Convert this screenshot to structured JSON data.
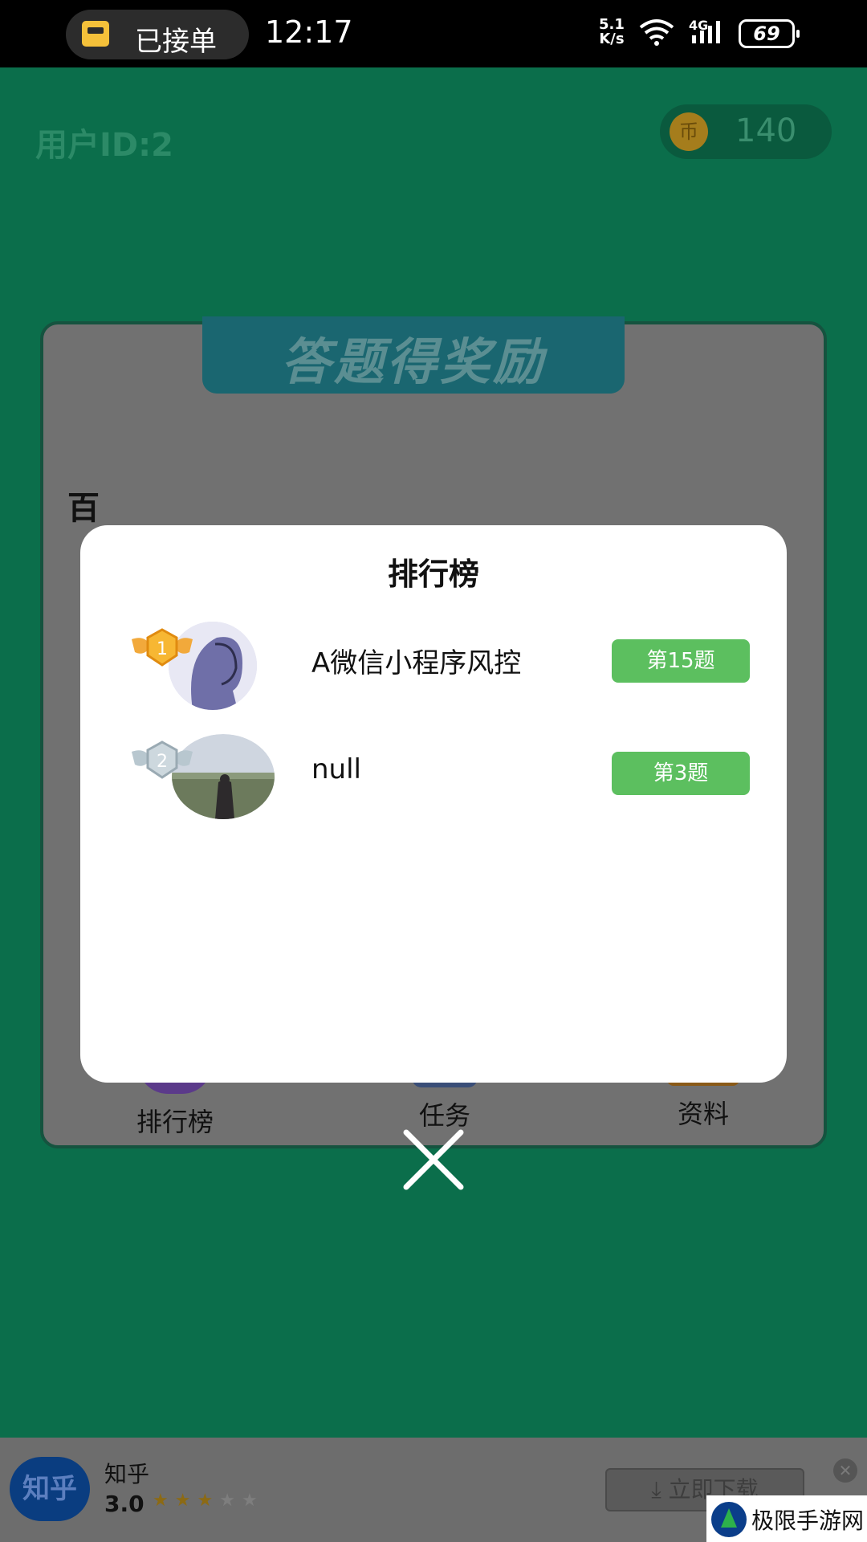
{
  "status_bar": {
    "notification": "已接单",
    "time": "12:17",
    "net_speed_value": "5.1",
    "net_speed_unit": "K/s",
    "signal_label": "4G",
    "battery": "69"
  },
  "app": {
    "user_id": "用户ID:2",
    "coin_symbol": "币",
    "coin_count": "140",
    "card_title": "答题得奖励",
    "partial_text": "百",
    "nav": [
      {
        "label": "排行榜",
        "icon": "crown-icon"
      },
      {
        "label": "任务",
        "icon": "clipboard-icon"
      },
      {
        "label": "资料",
        "icon": "id-card-icon"
      }
    ]
  },
  "modal": {
    "title": "排行榜",
    "entries": [
      {
        "rank": "1",
        "name": "A微信小程序风控",
        "level": "第15题",
        "badge": "gold-wings-badge"
      },
      {
        "rank": "2",
        "name": "null",
        "level": "第3题",
        "badge": "silver-wings-badge"
      }
    ],
    "close_icon": "close-icon"
  },
  "ad": {
    "logo_text": "知乎",
    "app_name": "知乎",
    "rating": "3.0",
    "stars_filled": 3,
    "stars_total": 5,
    "download_label": "立即下载"
  },
  "watermark": {
    "text": "极限手游网"
  },
  "colors": {
    "app_bg": "#0b6e4b",
    "button_green": "#5cbf5f",
    "gold": "#f2a93b",
    "silver": "#b8c7cf"
  }
}
